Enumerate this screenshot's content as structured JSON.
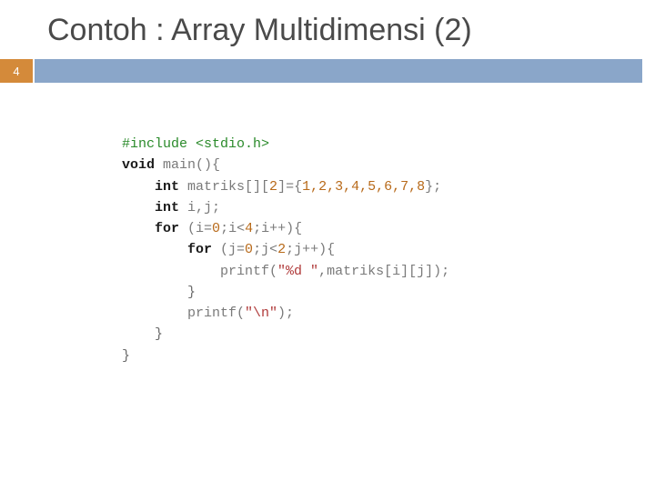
{
  "slide": {
    "title": "Contoh : Array Multidimensi (2)",
    "page_number": "4"
  },
  "code": {
    "l1_include": "#include <stdio.h>",
    "l2_kw": "void ",
    "l2_fn": "main(){",
    "l3_kw": "int ",
    "l3_rest_a": "matriks[][",
    "l3_num1": "2",
    "l3_rest_b": "]={",
    "l3_nums": "1,2,3,4,5,6,7,8",
    "l3_rest_c": "};",
    "l4_kw": "int ",
    "l4_rest": "i,j;",
    "l5_kw": "for ",
    "l5_a": "(i=",
    "l5_n0": "0",
    "l5_b": ";i<",
    "l5_n4": "4",
    "l5_c": ";i++){",
    "l6_kw": "for ",
    "l6_a": "(j=",
    "l6_n0": "0",
    "l6_b": ";j<",
    "l6_n2": "2",
    "l6_c": ";j++){",
    "l7_fn": "printf(",
    "l7_str": "\"%d \"",
    "l7_rest": ",matriks[i][j]);",
    "l8": "}",
    "l9_fn": "printf(",
    "l9_str": "\"\\n\"",
    "l9_rest": ");",
    "l10": "}",
    "l11": "}"
  }
}
